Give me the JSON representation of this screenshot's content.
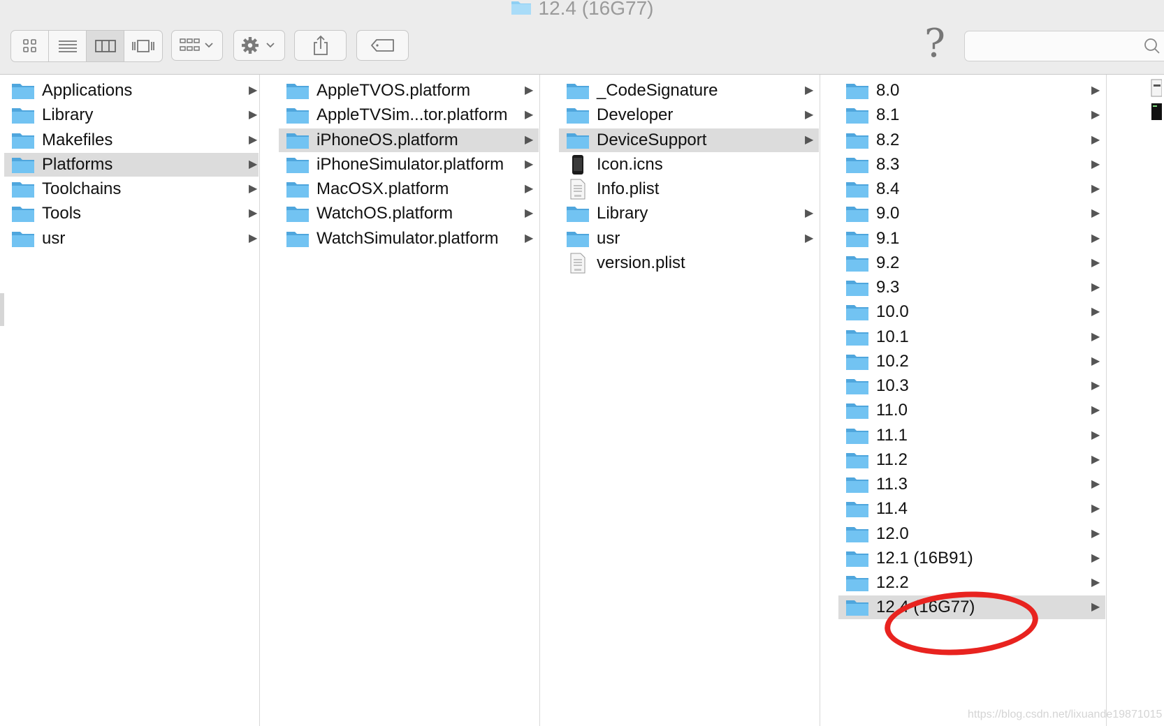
{
  "window": {
    "title": "12.4 (16G77)"
  },
  "toolbar": {
    "view_icons": [
      "icon-view-icon",
      "list-view-icon",
      "column-view-icon",
      "gallery-view-icon"
    ],
    "active_view_index": 2,
    "group_icon": "group-by-icon",
    "action_icon": "gear-icon",
    "share_icon": "share-icon",
    "tag_icon": "tag-icon",
    "help_label": "?",
    "search": {
      "value": "",
      "placeholder": ""
    }
  },
  "columns": [
    {
      "items": [
        {
          "label": "Applications",
          "type": "folder",
          "has_children": true,
          "selected": false
        },
        {
          "label": "Library",
          "type": "folder",
          "has_children": true,
          "selected": false
        },
        {
          "label": "Makefiles",
          "type": "folder",
          "has_children": true,
          "selected": false
        },
        {
          "label": "Platforms",
          "type": "folder",
          "has_children": true,
          "selected": true
        },
        {
          "label": "Toolchains",
          "type": "folder",
          "has_children": true,
          "selected": false
        },
        {
          "label": "Tools",
          "type": "folder",
          "has_children": true,
          "selected": false
        },
        {
          "label": "usr",
          "type": "folder",
          "has_children": true,
          "selected": false
        }
      ]
    },
    {
      "items": [
        {
          "label": "AppleTVOS.platform",
          "type": "folder",
          "has_children": true,
          "selected": false
        },
        {
          "label": "AppleTVSim...tor.platform",
          "type": "folder",
          "has_children": true,
          "selected": false
        },
        {
          "label": "iPhoneOS.platform",
          "type": "folder",
          "has_children": true,
          "selected": true
        },
        {
          "label": "iPhoneSimulator.platform",
          "type": "folder",
          "has_children": true,
          "selected": false
        },
        {
          "label": "MacOSX.platform",
          "type": "folder",
          "has_children": true,
          "selected": false
        },
        {
          "label": "WatchOS.platform",
          "type": "folder",
          "has_children": true,
          "selected": false
        },
        {
          "label": "WatchSimulator.platform",
          "type": "folder",
          "has_children": true,
          "selected": false
        }
      ]
    },
    {
      "items": [
        {
          "label": "_CodeSignature",
          "type": "folder",
          "has_children": true,
          "selected": false
        },
        {
          "label": "Developer",
          "type": "folder",
          "has_children": true,
          "selected": false
        },
        {
          "label": "DeviceSupport",
          "type": "folder",
          "has_children": true,
          "selected": true
        },
        {
          "label": "Icon.icns",
          "type": "icns",
          "has_children": false,
          "selected": false
        },
        {
          "label": "Info.plist",
          "type": "plist",
          "has_children": false,
          "selected": false
        },
        {
          "label": "Library",
          "type": "folder",
          "has_children": true,
          "selected": false
        },
        {
          "label": "usr",
          "type": "folder",
          "has_children": true,
          "selected": false
        },
        {
          "label": "version.plist",
          "type": "plist",
          "has_children": false,
          "selected": false
        }
      ]
    },
    {
      "items": [
        {
          "label": "8.0",
          "type": "folder",
          "has_children": true,
          "selected": false
        },
        {
          "label": "8.1",
          "type": "folder",
          "has_children": true,
          "selected": false
        },
        {
          "label": "8.2",
          "type": "folder",
          "has_children": true,
          "selected": false
        },
        {
          "label": "8.3",
          "type": "folder",
          "has_children": true,
          "selected": false
        },
        {
          "label": "8.4",
          "type": "folder",
          "has_children": true,
          "selected": false
        },
        {
          "label": "9.0",
          "type": "folder",
          "has_children": true,
          "selected": false
        },
        {
          "label": "9.1",
          "type": "folder",
          "has_children": true,
          "selected": false
        },
        {
          "label": "9.2",
          "type": "folder",
          "has_children": true,
          "selected": false
        },
        {
          "label": "9.3",
          "type": "folder",
          "has_children": true,
          "selected": false
        },
        {
          "label": "10.0",
          "type": "folder",
          "has_children": true,
          "selected": false
        },
        {
          "label": "10.1",
          "type": "folder",
          "has_children": true,
          "selected": false
        },
        {
          "label": "10.2",
          "type": "folder",
          "has_children": true,
          "selected": false
        },
        {
          "label": "10.3",
          "type": "folder",
          "has_children": true,
          "selected": false
        },
        {
          "label": "11.0",
          "type": "folder",
          "has_children": true,
          "selected": false
        },
        {
          "label": "11.1",
          "type": "folder",
          "has_children": true,
          "selected": false
        },
        {
          "label": "11.2",
          "type": "folder",
          "has_children": true,
          "selected": false
        },
        {
          "label": "11.3",
          "type": "folder",
          "has_children": true,
          "selected": false
        },
        {
          "label": "11.4",
          "type": "folder",
          "has_children": true,
          "selected": false
        },
        {
          "label": "12.0",
          "type": "folder",
          "has_children": true,
          "selected": false
        },
        {
          "label": "12.1 (16B91)",
          "type": "folder",
          "has_children": true,
          "selected": false
        },
        {
          "label": "12.2",
          "type": "folder",
          "has_children": true,
          "selected": false
        },
        {
          "label": "12.4 (16G77)",
          "type": "folder",
          "has_children": true,
          "selected": true
        }
      ]
    }
  ],
  "preview_icons": [
    "document-icon",
    "terminal-icon"
  ],
  "annotation": {
    "shape": "ellipse",
    "color": "#e8231f",
    "target": "12.4 (16G77)"
  },
  "watermark": "https://blog.csdn.net/lixuande19871015",
  "colors": {
    "folder": "#5fb6ec",
    "selection": "#dcdcdc",
    "annotation": "#e8231f"
  }
}
